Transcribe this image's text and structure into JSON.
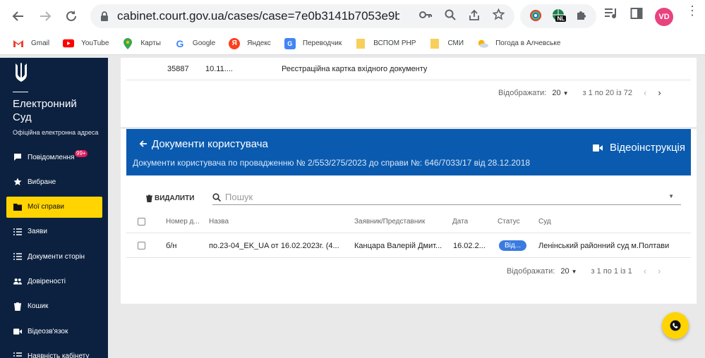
{
  "browser": {
    "url": "cabinet.court.gov.ua/cases/case=7e0b3141b7053e9b...",
    "avatar_initials": "VD",
    "ext_badge": "NL"
  },
  "bookmarks": [
    {
      "label": "Gmail",
      "icon": "gmail-icon"
    },
    {
      "label": "YouTube",
      "icon": "youtube-icon"
    },
    {
      "label": "Карты",
      "icon": "maps-icon"
    },
    {
      "label": "Google",
      "icon": "google-icon"
    },
    {
      "label": "Яндекс",
      "icon": "yandex-icon"
    },
    {
      "label": "Переводчик",
      "icon": "translate-icon"
    },
    {
      "label": "ВСПОМ PHP",
      "icon": "folder-icon"
    },
    {
      "label": "СМИ",
      "icon": "folder-icon"
    },
    {
      "label": "Погода в Алчевське",
      "icon": "weather-icon"
    }
  ],
  "sidebar": {
    "brand": "Електронний Суд",
    "brand_line1": "Електронний",
    "brand_line2": "Суд",
    "subtitle": "Офіційна електронна адреса",
    "notifications_badge": "99+",
    "items": [
      {
        "label": "Повідомлення",
        "icon": "message-icon"
      },
      {
        "label": "Вибране",
        "icon": "star-icon"
      },
      {
        "label": "Мої справи",
        "icon": "folder-icon"
      },
      {
        "label": "Заяви",
        "icon": "list-icon"
      },
      {
        "label": "Документи сторін",
        "icon": "list-icon"
      },
      {
        "label": "Довіреності",
        "icon": "people-icon"
      },
      {
        "label": "Кошик",
        "icon": "trash-icon"
      },
      {
        "label": "Відеозв'язок",
        "icon": "video-icon"
      },
      {
        "label": "Наявність кабінету",
        "icon": "list-icon"
      }
    ]
  },
  "top_table": {
    "row": {
      "number": "35887",
      "date": "10.11....",
      "name": "Реєстраційна картка вхідного документу"
    },
    "pager": {
      "label": "Відображати:",
      "per_page": "20",
      "range": "з 1 по 20 із 72"
    }
  },
  "documents": {
    "title": "Документи користувача",
    "subtitle": "Документи користувача по провадженню № 2/553/275/2023 до справи №: 646/7033/17 від 28.12.2018",
    "video_label": "Відеоінструкція",
    "delete_label": "ВИДАЛИТИ",
    "search_placeholder": "Пошук",
    "columns": {
      "number": "Номер д...",
      "name": "Назва",
      "applicant": "Заявник/Представник",
      "date": "Дата",
      "status": "Статус",
      "court": "Суд"
    },
    "row": {
      "number": "б/н",
      "name": "по.23-04_EK_UA от 16.02.2023г. (4...",
      "applicant": "Канцара Валерій Дмит...",
      "date": "16.02.2...",
      "status": "Від...",
      "court": "Ленінський районний суд м.Полтави"
    },
    "pager": {
      "label": "Відображати:",
      "per_page": "20",
      "range": "з 1 по 1 із 1"
    }
  },
  "colors": {
    "sidebar": "#0c2140",
    "accent": "#ffd400",
    "header_blue": "#0a5bb0",
    "status": "#3a7be0"
  }
}
